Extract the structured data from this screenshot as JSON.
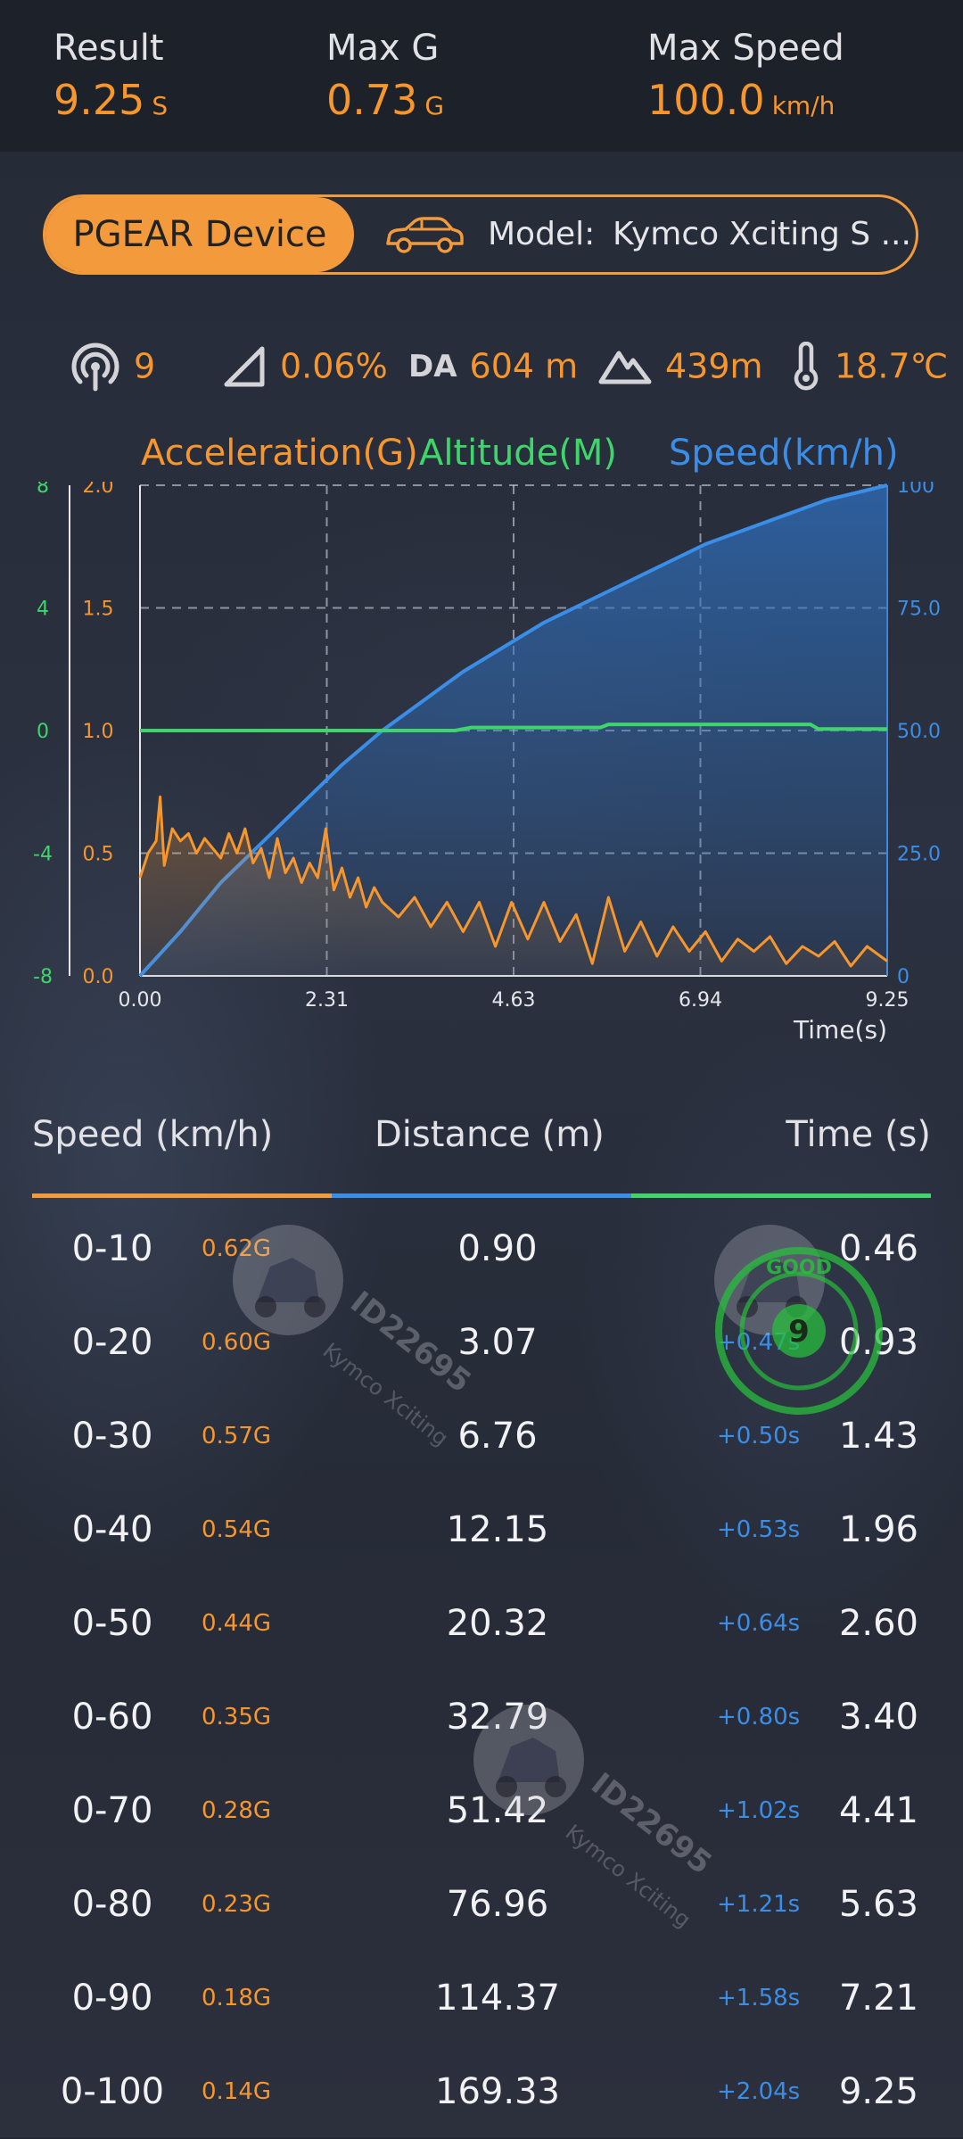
{
  "header": {
    "result": {
      "label": "Result",
      "value": "9.25",
      "unit": "S"
    },
    "max_g": {
      "label": "Max G",
      "value": "0.73",
      "unit": "G"
    },
    "max_speed": {
      "label": "Max Speed",
      "value": "100.0",
      "unit": "km/h"
    }
  },
  "device": {
    "button_label": "PGEAR Device",
    "model_label": "Model:",
    "model_value": "Kymco Xciting S ..."
  },
  "conditions": {
    "satellites": "9",
    "slope": "0.06%",
    "da_label": "DA",
    "da_value": "604 m",
    "altitude": "439m",
    "temperature": "18.7℃"
  },
  "colors": {
    "accent_orange": "#f7962c",
    "green": "#3ed66a",
    "blue": "#3a8ee8"
  },
  "chart_data": {
    "type": "line",
    "legend": [
      "Acceleration(G)",
      "Altitude(M)",
      "Speed(km/h)"
    ],
    "xlabel": "Time(s)",
    "x_ticks": [
      "0.00",
      "2.31",
      "4.63",
      "6.94",
      "9.25"
    ],
    "xlim": [
      0,
      9.25
    ],
    "left_axis_altitude_ticks": [
      "8",
      "4",
      "0",
      "-4",
      "-8"
    ],
    "left_axis_accel_ticks": [
      "2.0",
      "1.5",
      "1.0",
      "0.5",
      "0.0"
    ],
    "right_axis_speed_ticks": [
      "100",
      "75.0",
      "50.0",
      "25.0",
      "0"
    ],
    "grid": true,
    "series": [
      {
        "name": "Speed(km/h)",
        "axis": "right",
        "ylim": [
          0,
          100
        ],
        "x": [
          0,
          0.5,
          1.0,
          1.5,
          2.0,
          2.5,
          3.0,
          3.5,
          4.0,
          4.5,
          5.0,
          5.5,
          6.0,
          6.5,
          7.0,
          7.5,
          8.0,
          8.5,
          9.0,
          9.25
        ],
        "values": [
          0,
          9,
          19,
          27,
          35,
          43,
          50,
          56,
          62,
          67,
          72,
          76,
          80,
          84,
          88,
          91,
          94,
          97,
          99,
          100
        ]
      },
      {
        "name": "Altitude(M)",
        "axis": "left_outer",
        "ylim": [
          -8,
          8
        ],
        "x": [
          0,
          3.9,
          4.1,
          5.7,
          5.8,
          8.3,
          8.4,
          9.25
        ],
        "values": [
          0,
          0,
          0.1,
          0.1,
          0.2,
          0.2,
          0.05,
          0.05
        ]
      },
      {
        "name": "Acceleration(G)",
        "axis": "left_inner",
        "ylim": [
          0,
          2.0
        ],
        "x": [
          0,
          0.1,
          0.2,
          0.25,
          0.3,
          0.4,
          0.5,
          0.6,
          0.7,
          0.8,
          0.9,
          1.0,
          1.1,
          1.2,
          1.3,
          1.4,
          1.5,
          1.6,
          1.7,
          1.8,
          1.9,
          2.0,
          2.1,
          2.2,
          2.3,
          2.4,
          2.5,
          2.6,
          2.7,
          2.8,
          2.9,
          3.0,
          3.2,
          3.4,
          3.6,
          3.8,
          4.0,
          4.2,
          4.4,
          4.6,
          4.8,
          5.0,
          5.2,
          5.4,
          5.6,
          5.8,
          6.0,
          6.2,
          6.4,
          6.6,
          6.8,
          7.0,
          7.2,
          7.4,
          7.6,
          7.8,
          8.0,
          8.2,
          8.4,
          8.6,
          8.8,
          9.0,
          9.25
        ],
        "values": [
          0.4,
          0.5,
          0.55,
          0.73,
          0.45,
          0.6,
          0.55,
          0.58,
          0.5,
          0.56,
          0.52,
          0.48,
          0.58,
          0.5,
          0.6,
          0.46,
          0.52,
          0.4,
          0.56,
          0.42,
          0.48,
          0.38,
          0.46,
          0.4,
          0.6,
          0.35,
          0.44,
          0.32,
          0.4,
          0.28,
          0.36,
          0.3,
          0.24,
          0.32,
          0.2,
          0.3,
          0.18,
          0.3,
          0.12,
          0.3,
          0.15,
          0.3,
          0.14,
          0.25,
          0.05,
          0.32,
          0.1,
          0.22,
          0.08,
          0.2,
          0.1,
          0.18,
          0.06,
          0.15,
          0.1,
          0.16,
          0.05,
          0.12,
          0.08,
          0.14,
          0.04,
          0.12,
          0.06
        ]
      }
    ]
  },
  "table": {
    "headers": {
      "speed": "Speed (km/h)",
      "distance": "Distance (m)",
      "time": "Time (s)"
    },
    "rows": [
      {
        "range": "0-10",
        "g": "0.62G",
        "distance": "0.90",
        "delta": "",
        "time": "0.46"
      },
      {
        "range": "0-20",
        "g": "0.60G",
        "distance": "3.07",
        "delta": "+0.47s",
        "time": "0.93"
      },
      {
        "range": "0-30",
        "g": "0.57G",
        "distance": "6.76",
        "delta": "+0.50s",
        "time": "1.43"
      },
      {
        "range": "0-40",
        "g": "0.54G",
        "distance": "12.15",
        "delta": "+0.53s",
        "time": "1.96"
      },
      {
        "range": "0-50",
        "g": "0.44G",
        "distance": "20.32",
        "delta": "+0.64s",
        "time": "2.60"
      },
      {
        "range": "0-60",
        "g": "0.35G",
        "distance": "32.79",
        "delta": "+0.80s",
        "time": "3.40"
      },
      {
        "range": "0-70",
        "g": "0.28G",
        "distance": "51.42",
        "delta": "+1.02s",
        "time": "4.41"
      },
      {
        "range": "0-80",
        "g": "0.23G",
        "distance": "76.96",
        "delta": "+1.21s",
        "time": "5.63"
      },
      {
        "range": "0-90",
        "g": "0.18G",
        "distance": "114.37",
        "delta": "+1.58s",
        "time": "7.21"
      },
      {
        "range": "0-100",
        "g": "0.14G",
        "distance": "169.33",
        "delta": "+2.04s",
        "time": "9.25"
      }
    ]
  },
  "watermark": {
    "id": "ID22695",
    "model": "Kymco Xciting",
    "stamp": "GOOD"
  }
}
